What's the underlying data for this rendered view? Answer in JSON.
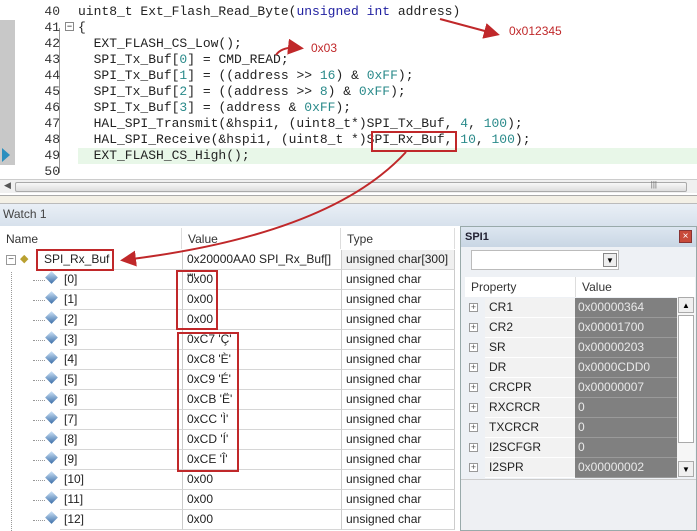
{
  "editor": {
    "current_line": 49,
    "lines": [
      {
        "n": "40",
        "tokens": [
          [
            "uint8_t Ext_Flash_Read_Byte(",
            ""
          ],
          [
            "unsigned int",
            "kw"
          ],
          [
            " address)",
            ""
          ]
        ]
      },
      {
        "n": "41",
        "tokens": [
          [
            "{",
            ""
          ]
        ]
      },
      {
        "n": "42",
        "tokens": [
          [
            "  EXT_FLASH_CS_Low();",
            ""
          ]
        ]
      },
      {
        "n": "43",
        "tokens": [
          [
            "  SPI_Tx_Buf[",
            ""
          ],
          [
            "0",
            "num"
          ],
          [
            "] = CMD_READ;",
            ""
          ]
        ]
      },
      {
        "n": "44",
        "tokens": [
          [
            "  SPI_Tx_Buf[",
            ""
          ],
          [
            "1",
            "num"
          ],
          [
            "] = ((address >> ",
            ""
          ],
          [
            "16",
            "num"
          ],
          [
            ") & ",
            ""
          ],
          [
            "0xFF",
            "num"
          ],
          [
            ");",
            ""
          ]
        ]
      },
      {
        "n": "45",
        "tokens": [
          [
            "  SPI_Tx_Buf[",
            ""
          ],
          [
            "2",
            "num"
          ],
          [
            "] = ((address >> ",
            ""
          ],
          [
            "8",
            "num"
          ],
          [
            ") & ",
            ""
          ],
          [
            "0xFF",
            "num"
          ],
          [
            ");",
            ""
          ]
        ]
      },
      {
        "n": "46",
        "tokens": [
          [
            "  SPI_Tx_Buf[",
            ""
          ],
          [
            "3",
            "num"
          ],
          [
            "] = (address & ",
            ""
          ],
          [
            "0xFF",
            "num"
          ],
          [
            ");",
            ""
          ]
        ]
      },
      {
        "n": "47",
        "tokens": [
          [
            "  HAL_SPI_Transmit(&hspi1, (uint8_t*)SPI_Tx_Buf, ",
            ""
          ],
          [
            "4",
            "num"
          ],
          [
            ", ",
            ""
          ],
          [
            "100",
            "num"
          ],
          [
            ");",
            ""
          ]
        ]
      },
      {
        "n": "48",
        "tokens": [
          [
            "  HAL_SPI_Receive(&hspi1, (uint8_t *)SPI_Rx_Buf, ",
            ""
          ],
          [
            "10",
            "num"
          ],
          [
            ", ",
            ""
          ],
          [
            "100",
            "num"
          ],
          [
            ");",
            ""
          ]
        ]
      },
      {
        "n": "49",
        "tokens": [
          [
            "  EXT_FLASH_CS_High();",
            ""
          ]
        ]
      },
      {
        "n": "50",
        "tokens": [
          [
            "",
            ""
          ]
        ]
      }
    ]
  },
  "annotations": {
    "address_value": "0x012345",
    "cmd_read_value": "0x03",
    "color": "#c0282a"
  },
  "watch": {
    "tab": "Watch 1",
    "headers": {
      "name": "Name",
      "value": "Value",
      "type": "Type"
    },
    "root": {
      "name": "SPI_Rx_Buf",
      "value": "0x20000AA0 SPI_Rx_Buf[] \"\"",
      "type": "unsigned char[300]",
      "expand": "−"
    },
    "rows": [
      {
        "name": "[0]",
        "value": "0x00",
        "type": "unsigned char"
      },
      {
        "name": "[1]",
        "value": "0x00",
        "type": "unsigned char"
      },
      {
        "name": "[2]",
        "value": "0x00",
        "type": "unsigned char"
      },
      {
        "name": "[3]",
        "value": "0xC7 'Ç'",
        "type": "unsigned char"
      },
      {
        "name": "[4]",
        "value": "0xC8 'È'",
        "type": "unsigned char"
      },
      {
        "name": "[5]",
        "value": "0xC9 'É'",
        "type": "unsigned char"
      },
      {
        "name": "[6]",
        "value": "0xCB 'Ë'",
        "type": "unsigned char"
      },
      {
        "name": "[7]",
        "value": "0xCC 'Ì'",
        "type": "unsigned char"
      },
      {
        "name": "[8]",
        "value": "0xCD 'Í'",
        "type": "unsigned char"
      },
      {
        "name": "[9]",
        "value": "0xCE 'Î'",
        "type": "unsigned char"
      },
      {
        "name": "[10]",
        "value": "0x00",
        "type": "unsigned char"
      },
      {
        "name": "[11]",
        "value": "0x00",
        "type": "unsigned char"
      },
      {
        "name": "[12]",
        "value": "0x00",
        "type": "unsigned char"
      }
    ]
  },
  "spi": {
    "title": "SPI1",
    "close": "×",
    "dropdown_arrow": "▼",
    "headers": {
      "property": "Property",
      "value": "Value"
    },
    "rows": [
      {
        "p": "CR1",
        "v": "0x00000364"
      },
      {
        "p": "CR2",
        "v": "0x00001700"
      },
      {
        "p": "SR",
        "v": "0x00000203"
      },
      {
        "p": "DR",
        "v": "0x0000CDD0"
      },
      {
        "p": "CRCPR",
        "v": "0x00000007"
      },
      {
        "p": "RXCRCR",
        "v": "0"
      },
      {
        "p": "TXCRCR",
        "v": "0"
      },
      {
        "p": "I2SCFGR",
        "v": "0"
      },
      {
        "p": "I2SPR",
        "v": "0x00000002"
      }
    ]
  }
}
